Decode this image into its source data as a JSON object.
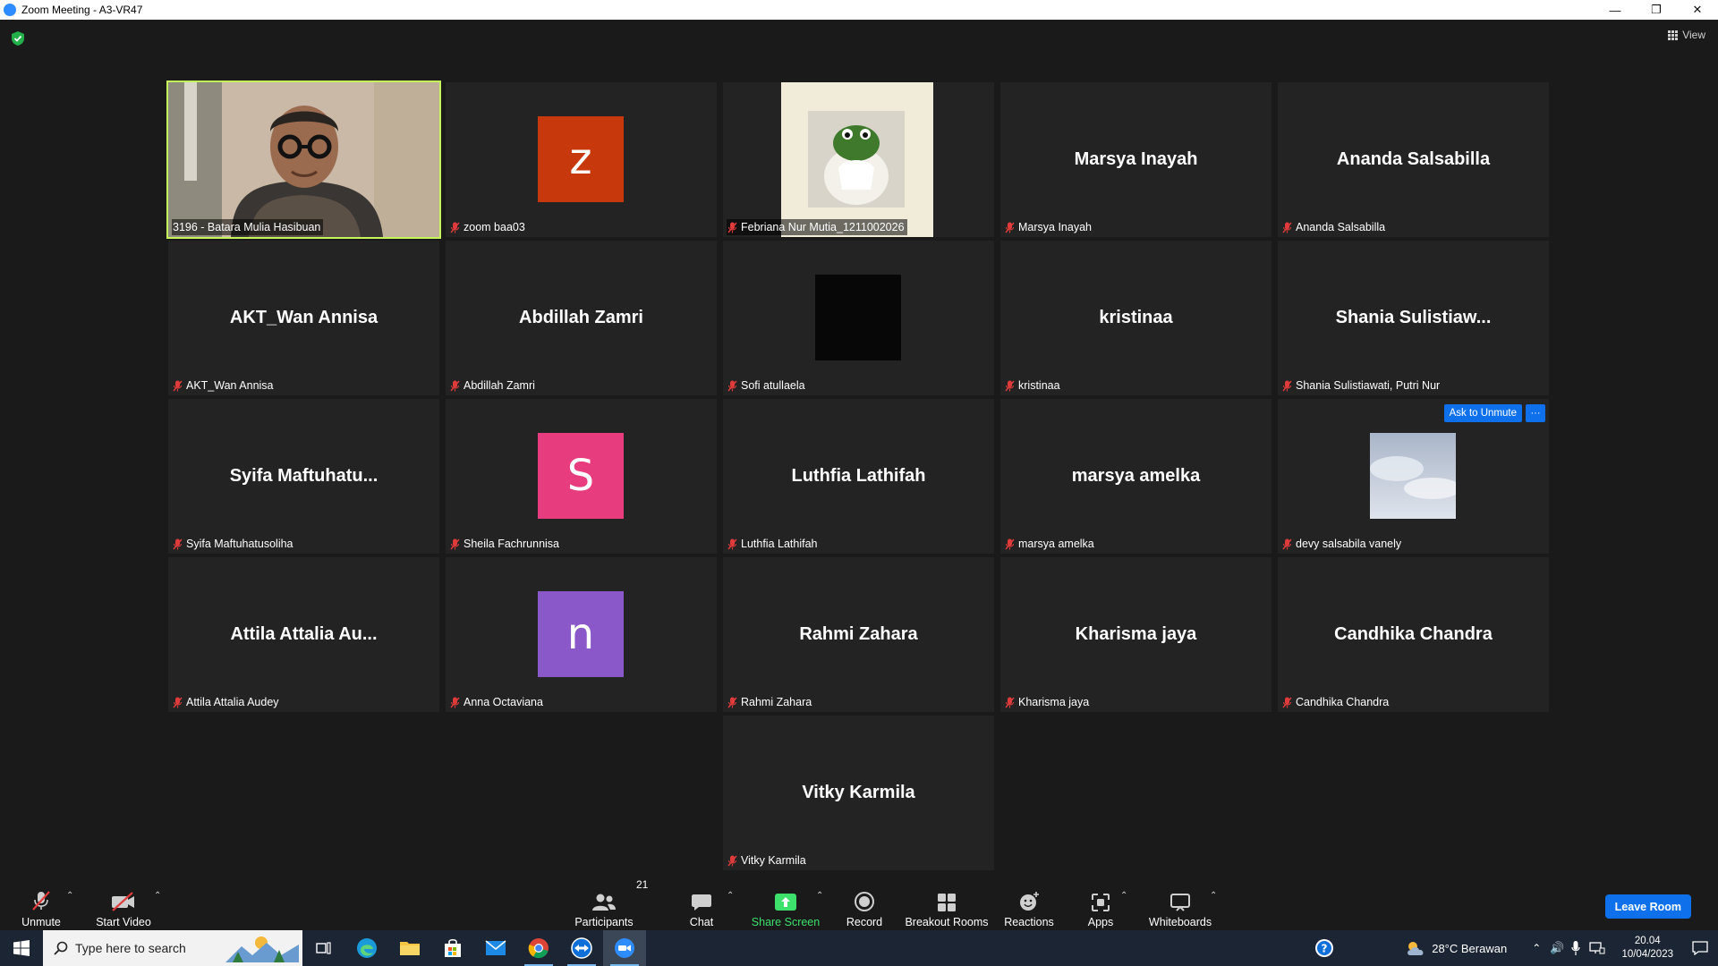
{
  "window": {
    "title": "Zoom Meeting - A3-VR47"
  },
  "top": {
    "view_label": "View"
  },
  "tiles": [
    {
      "kind": "video",
      "name": "3196 - Batara Mulia Hasibuan",
      "active": true
    },
    {
      "kind": "avatar",
      "letter": "z",
      "color": "#c8380d",
      "name": "zoom baa03"
    },
    {
      "kind": "image",
      "name": "Febriana Nur Mutia_1211002026"
    },
    {
      "kind": "text",
      "display": "Marsya Inayah",
      "name": "Marsya Inayah"
    },
    {
      "kind": "text",
      "display": "Ananda Salsabilla",
      "name": "Ananda Salsabilla"
    },
    {
      "kind": "text",
      "display": "AKT_Wan Annisa",
      "name": "AKT_Wan Annisa"
    },
    {
      "kind": "text",
      "display": "Abdillah Zamri",
      "name": "Abdillah Zamri"
    },
    {
      "kind": "black",
      "name": "Sofi atullaela"
    },
    {
      "kind": "text",
      "display": "kristinaa",
      "name": "kristinaa"
    },
    {
      "kind": "text",
      "display": "Shania  Sulistiaw...",
      "name": "Shania Sulistiawati, Putri Nur"
    },
    {
      "kind": "text",
      "display": "Syifa  Maftuhatu...",
      "name": "Syifa Maftuhatusoliha"
    },
    {
      "kind": "avatar",
      "letter": "S",
      "color": "#e73c7e",
      "name": "Sheila Fachrunnisa"
    },
    {
      "kind": "text",
      "display": "Luthfia Lathifah",
      "name": "Luthfia Lathifah"
    },
    {
      "kind": "text",
      "display": "marsya amelka",
      "name": "marsya amelka"
    },
    {
      "kind": "sky",
      "name": "devy salsabila vanely",
      "ask_unmute": "Ask to Unmute",
      "more": "···"
    },
    {
      "kind": "text",
      "display": "Attila Attalia Au...",
      "name": "Attila Attalia Audey"
    },
    {
      "kind": "avatar",
      "letter": "n",
      "color": "#8a58c8",
      "name": "Anna Octaviana"
    },
    {
      "kind": "text",
      "display": "Rahmi Zahara",
      "name": "Rahmi Zahara"
    },
    {
      "kind": "text",
      "display": "Kharisma jaya",
      "name": "Kharisma jaya"
    },
    {
      "kind": "text",
      "display": "Candhika Chandra",
      "name": "Candhika Chandra"
    },
    {
      "kind": "text",
      "display": "Vitky Karmila",
      "name": "Vitky Karmila"
    }
  ],
  "toolbar": {
    "unmute": "Unmute",
    "start_video": "Start Video",
    "participants": "Participants",
    "participants_count": "21",
    "chat": "Chat",
    "share_screen": "Share Screen",
    "record": "Record",
    "breakout_rooms": "Breakout Rooms",
    "reactions": "Reactions",
    "apps": "Apps",
    "whiteboards": "Whiteboards",
    "leave_room": "Leave Room"
  },
  "taskbar": {
    "search_placeholder": "Type here to search",
    "weather": "28°C  Berawan",
    "time": "20.04",
    "date": "10/04/2023"
  },
  "colors": {
    "accent_blue": "#0e71eb",
    "active_speaker": "#c6f45a",
    "share_green": "#3ce06a"
  }
}
